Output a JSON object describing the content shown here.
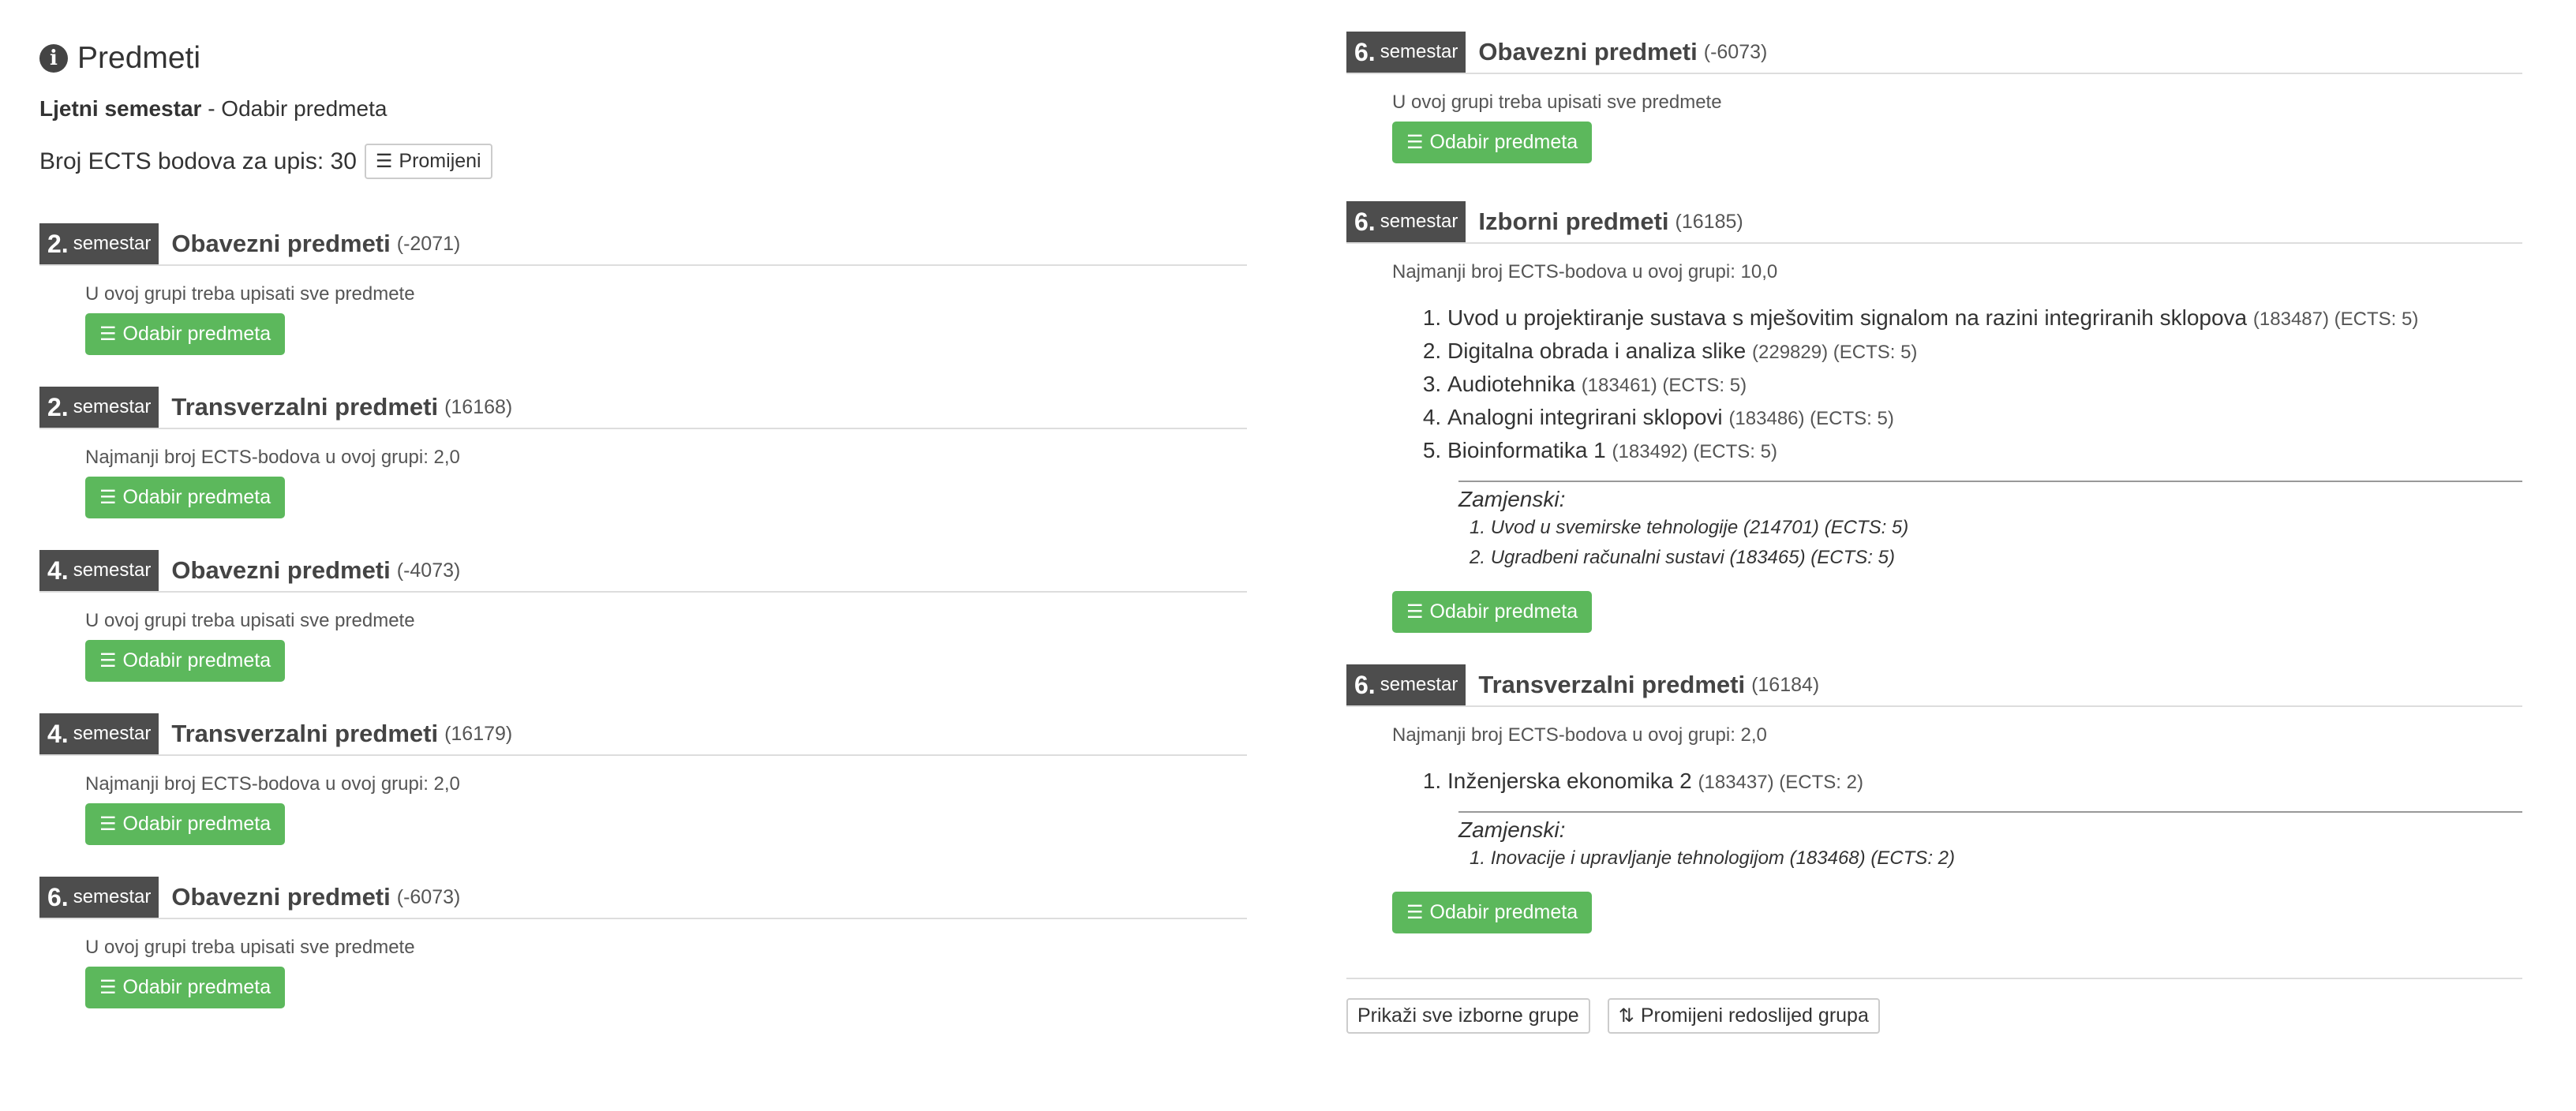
{
  "header": {
    "title": "Predmeti",
    "subtitle_bold": "Ljetni semestar",
    "subtitle_rest": " - Odabir predmeta",
    "ects_text": "Broj ECTS bodova za upis: 30",
    "change_button": "Promijeni"
  },
  "common": {
    "semestar_word": "semestar",
    "select_button": "Odabir predmeta",
    "alt_title": "Zamjenski:"
  },
  "left_groups": [
    {
      "sem": "2.",
      "title": "Obavezni predmeti",
      "code": "(-2071)",
      "note": "U ovoj grupi treba upisati sve predmete"
    },
    {
      "sem": "2.",
      "title": "Transverzalni predmeti",
      "code": "(16168)",
      "note": "Najmanji broj ECTS-bodova u ovoj grupi: 2,0"
    },
    {
      "sem": "4.",
      "title": "Obavezni predmeti",
      "code": "(-4073)",
      "note": "U ovoj grupi treba upisati sve predmete"
    },
    {
      "sem": "4.",
      "title": "Transverzalni predmeti",
      "code": "(16179)",
      "note": "Najmanji broj ECTS-bodova u ovoj grupi: 2,0"
    },
    {
      "sem": "6.",
      "title": "Obavezni predmeti",
      "code": "(-6073)",
      "note": "U ovoj grupi treba upisati sve predmete"
    }
  ],
  "right_groups": [
    {
      "sem": "6.",
      "title": "Obavezni predmeti",
      "code": "(-6073)",
      "note": "U ovoj grupi treba upisati sve predmete"
    },
    {
      "sem": "6.",
      "title": "Izborni predmeti",
      "code": "(16185)",
      "note": "Najmanji broj ECTS-bodova u ovoj grupi: 10,0",
      "courses": [
        {
          "name": "Uvod u projektiranje sustava s mješovitim signalom na razini integriranih sklopova",
          "meta": "(183487) (ECTS: 5)"
        },
        {
          "name": "Digitalna obrada i analiza slike",
          "meta": "(229829) (ECTS: 5)"
        },
        {
          "name": "Audiotehnika",
          "meta": "(183461) (ECTS: 5)"
        },
        {
          "name": "Analogni integrirani sklopovi",
          "meta": "(183486) (ECTS: 5)"
        },
        {
          "name": "Bioinformatika 1",
          "meta": "(183492) (ECTS: 5)"
        }
      ],
      "alternatives": [
        "Uvod u svemirske tehnologije (214701) (ECTS: 5)",
        "Ugradbeni računalni sustavi (183465) (ECTS: 5)"
      ]
    },
    {
      "sem": "6.",
      "title": "Transverzalni predmeti",
      "code": "(16184)",
      "note": "Najmanji broj ECTS-bodova u ovoj grupi: 2,0",
      "courses": [
        {
          "name": "Inženjerska ekonomika 2",
          "meta": "(183437) (ECTS: 2)"
        }
      ],
      "alternatives": [
        "Inovacije i upravljanje tehnologijom (183468) (ECTS: 2)"
      ]
    }
  ],
  "footer": {
    "show_all_button": "Prikaži sve izborne grupe",
    "reorder_button": "Promijeni redoslijed grupa"
  },
  "colors": {
    "green": "#5cb85c",
    "dark_label": "#4d4d4d"
  },
  "icons": {
    "info": "info-icon",
    "list": "list-icon",
    "sort": "sort-icon"
  }
}
